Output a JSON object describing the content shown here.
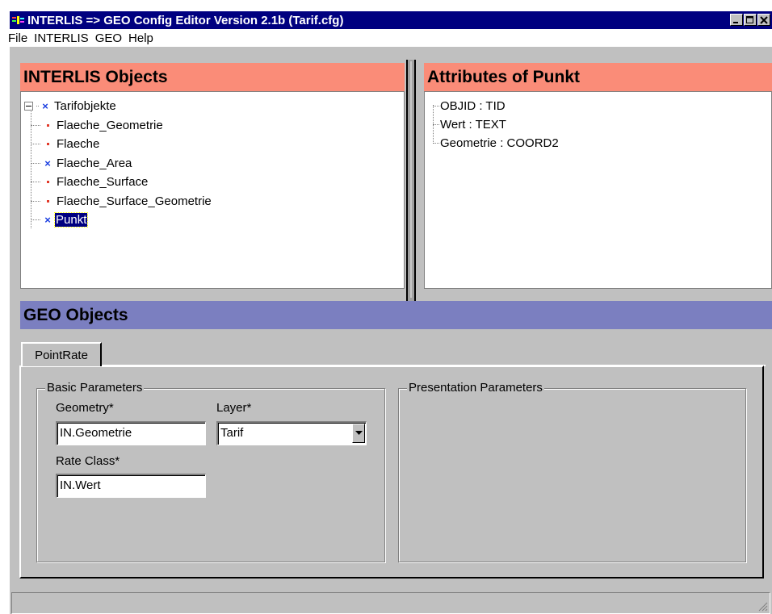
{
  "window": {
    "title": "INTERLIS => GEO Config Editor Version 2.1b (Tarif.cfg)",
    "controls": [
      "minimize-icon",
      "maximize-icon",
      "close-icon"
    ]
  },
  "menu": {
    "items": [
      "File",
      "INTERLIS",
      "GEO",
      "Help"
    ]
  },
  "interlis_panel": {
    "title": "INTERLIS Objects",
    "root": "Tarifobjekte",
    "children": [
      {
        "label": "Flaeche_Geometrie",
        "icon": "dot-icon"
      },
      {
        "label": "Flaeche",
        "icon": "dot-icon"
      },
      {
        "label": "Flaeche_Area",
        "icon": "x-icon"
      },
      {
        "label": "Flaeche_Surface",
        "icon": "dot-icon"
      },
      {
        "label": "Flaeche_Surface_Geometrie",
        "icon": "dot-icon"
      },
      {
        "label": "Punkt",
        "icon": "x-icon",
        "selected": true
      }
    ]
  },
  "attributes_panel": {
    "title": "Attributes of Punkt",
    "items": [
      "OBJID : TID",
      "Wert : TEXT",
      "Geometrie : COORD2"
    ]
  },
  "geo_panel": {
    "title": "GEO Objects",
    "tab": "PointRate",
    "basic": {
      "legend": "Basic Parameters",
      "geometry_label": "Geometry*",
      "geometry_value": "IN.Geometrie",
      "layer_label": "Layer*",
      "layer_value": "Tarif",
      "rate_class_label": "Rate Class*",
      "rate_class_value": "IN.Wert"
    },
    "presentation": {
      "legend": "Presentation Parameters"
    }
  },
  "colors": {
    "titlebar": "#000080",
    "interlis_header": "#fa8c78",
    "geo_header": "#7b7fc0",
    "window_face": "#c0c0c0"
  }
}
